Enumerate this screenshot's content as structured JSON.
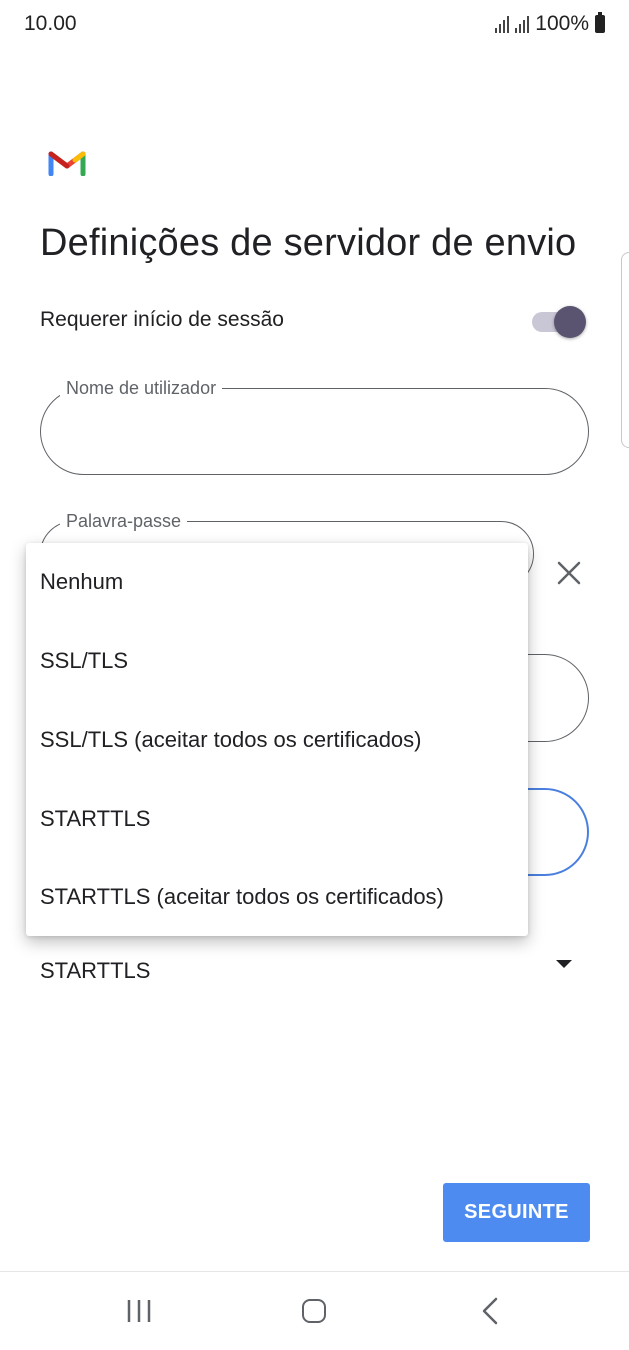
{
  "status_bar": {
    "time": "10.00",
    "battery": "100%"
  },
  "header": {
    "title": "Definições de servidor de envio"
  },
  "require_login": {
    "label": "Requerer início de sessão",
    "enabled": true
  },
  "fields": {
    "username": {
      "label": "Nome de utilizador",
      "value": ""
    },
    "password": {
      "label": "Palavra-passe",
      "value": ""
    }
  },
  "security": {
    "selected": "STARTTLS"
  },
  "menu": {
    "items": [
      {
        "label": "Nenhum"
      },
      {
        "label": "SSL/TLS"
      },
      {
        "label": "SSL/TLS (aceitar todos os certificados)"
      },
      {
        "label": "STARTTLS"
      },
      {
        "label": "STARTTLS (aceitar todos os certificados)"
      }
    ]
  },
  "actions": {
    "next": "SEGUINTE"
  },
  "colors": {
    "primary": "#4d8bf0",
    "toggle_knob": "#5a5470",
    "toggle_track": "#c9c6d6"
  },
  "icons": {
    "logo": "gmail-logo-icon",
    "clear": "close-icon",
    "signal": "signal-icon",
    "battery": "battery-icon",
    "recents": "recents-icon",
    "home": "home-icon",
    "back": "back-icon",
    "dropdown": "dropdown-arrow-icon"
  }
}
